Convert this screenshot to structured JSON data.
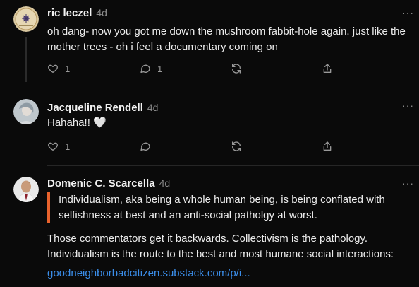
{
  "comments": [
    {
      "author": "ric leczel",
      "age": "4d",
      "more": "···",
      "text": "oh dang- now you got me down the mushroom fabbit-hole again. just like the mother trees - oh i feel a documentary coming on",
      "likes": "1",
      "replies": "1"
    },
    {
      "author": "Jacqueline Rendell",
      "age": "4d",
      "more": "···",
      "text": "Hahaha!! 🤍",
      "likes": "1"
    },
    {
      "author": "Domenic C. Scarcella",
      "age": "4d",
      "more": "···",
      "quote": "Individualism, aka being a whole human being, is being conflated with selfishness at best and an anti-social patholgy at worst.",
      "text": "Those commentators get it backwards. Collectivism is the pathology. Individualism is the route to the best and most humane social interactions:",
      "link": "goodneighborbadcitizen.substack.com/p/i..."
    }
  ],
  "colors": {
    "accent_quote": "#e8622c",
    "link": "#3b8eea",
    "background": "#0a0a0a"
  },
  "icons": [
    "heart-icon",
    "comment-icon",
    "restack-icon",
    "share-icon",
    "more-icon"
  ]
}
